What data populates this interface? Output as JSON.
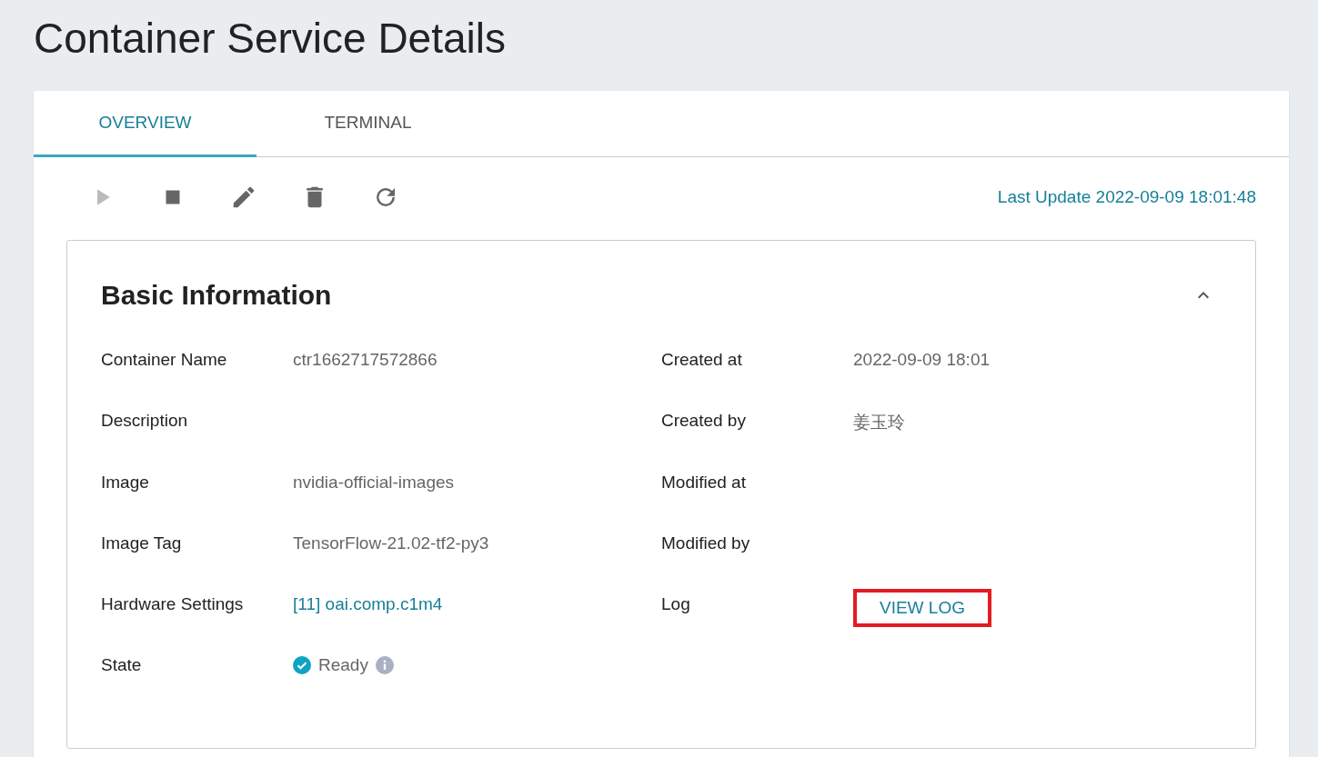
{
  "page_title": "Container Service Details",
  "tabs": [
    {
      "label": "OVERVIEW",
      "selected": true
    },
    {
      "label": "TERMINAL",
      "selected": false
    }
  ],
  "toolbar": [
    {
      "kind": "play",
      "disabled": true
    },
    {
      "kind": "stop",
      "disabled": false
    },
    {
      "kind": "edit",
      "disabled": false
    },
    {
      "kind": "delete",
      "disabled": false
    },
    {
      "kind": "refresh",
      "disabled": false
    }
  ],
  "last_update": "Last Update 2022-09-09 18:01:48",
  "section": {
    "title": "Basic Information",
    "expanded": true,
    "left": [
      {
        "label": "Container Name",
        "kind": "text",
        "value": "ctr1662717572866"
      },
      {
        "label": "Description",
        "kind": "text"
      },
      {
        "label": "Image",
        "kind": "text",
        "value": "nvidia-official-images"
      },
      {
        "label": "Image Tag",
        "kind": "text",
        "value": "TensorFlow-21.02-tf2-py3"
      },
      {
        "label": "Hardware Settings",
        "kind": "link",
        "value": "[11] oai.comp.c1m4"
      },
      {
        "label": "State",
        "kind": "status",
        "value": "Ready"
      }
    ],
    "right": [
      {
        "label": "Created at",
        "kind": "text",
        "value": "2022-09-09 18:01"
      },
      {
        "label": "Created by",
        "kind": "text",
        "value": "姜玉玲"
      },
      {
        "label": "Modified at",
        "kind": "text"
      },
      {
        "label": "Modified by",
        "kind": "text"
      },
      {
        "label": "Log",
        "kind": "button",
        "value": "VIEW LOG",
        "highlighted": true
      }
    ]
  }
}
